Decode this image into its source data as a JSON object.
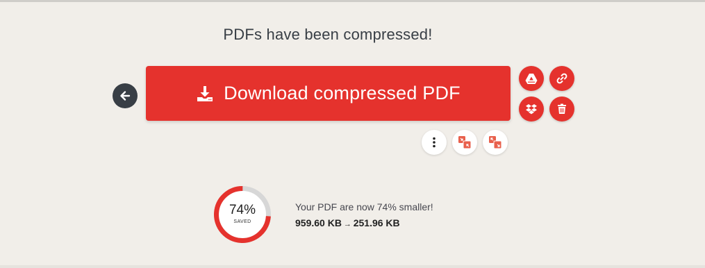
{
  "header": {
    "title": "PDFs have been compressed!"
  },
  "actions": {
    "download_label": "Download compressed PDF"
  },
  "result": {
    "saved_percent": "74%",
    "saved_label": "SAVED",
    "saved_fraction": 0.74,
    "message": "Your PDF are now 74% smaller!",
    "original_size": "959.60 KB",
    "arrow": "→",
    "compressed_size": "251.96 KB"
  },
  "colors": {
    "accent": "#e5322d",
    "dark": "#383e45",
    "background": "#f1eee9",
    "gauge_track": "#d7d7d7"
  }
}
